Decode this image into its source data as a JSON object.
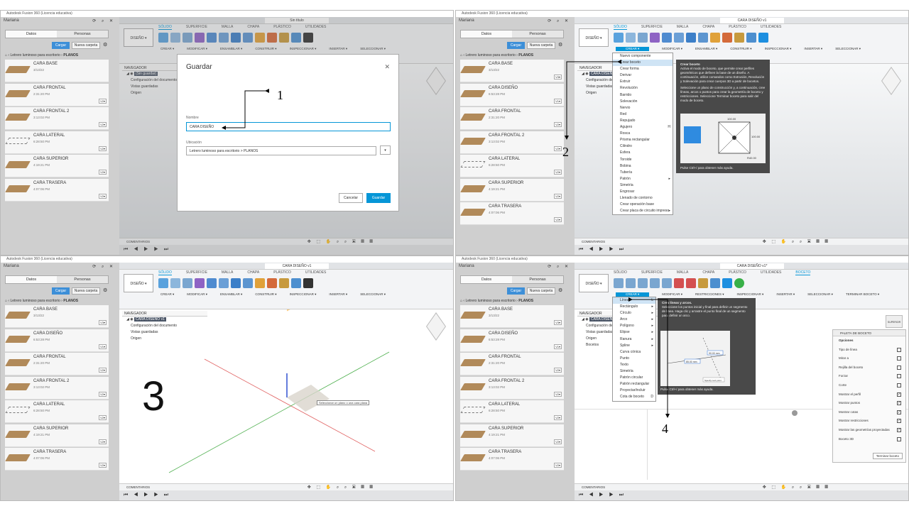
{
  "app_title": "Autodesk Fusion 360 (Licencia educativa)",
  "account": "Mariana",
  "panel": {
    "tabs": [
      "Datos",
      "Personas"
    ],
    "load_button": "Cargar",
    "new_folder_button": "Nueva carpeta",
    "breadcrumb_a": "Letrero luminoso para escritorio",
    "breadcrumb_b": "PLANOS",
    "files_q1": [
      {
        "name": "CARA BASE",
        "time": "3/13/22",
        "ver": ""
      },
      {
        "name": "CARA FRONTAL",
        "time": "2:31:20 PM",
        "ver": "V2▾"
      },
      {
        "name": "CARA FRONTAL 2",
        "time": "3:13:02 PM",
        "ver": "V2▾"
      },
      {
        "name": "CARA LATERAL",
        "time": "6:28:50 PM",
        "ver": "V2▾"
      },
      {
        "name": "CARA SUPERIOR",
        "time": "4:19:21 PM",
        "ver": "V2▾"
      },
      {
        "name": "CARA TRASERA",
        "time": "4:07:06 PM",
        "ver": "V2▾"
      }
    ],
    "files": [
      {
        "name": "CARA BASE",
        "time": "3/13/22",
        "ver": "V3▾"
      },
      {
        "name": "CARA DISEÑO",
        "time": "6:53:28 PM",
        "ver": "V1▾"
      },
      {
        "name": "CARA FRONTAL",
        "time": "2:31:20 PM",
        "ver": "V2▾"
      },
      {
        "name": "CARA FRONTAL 2",
        "time": "3:13:02 PM",
        "ver": "V2▾"
      },
      {
        "name": "CARA LATERAL",
        "time": "6:28:50 PM",
        "ver": "V2▾"
      },
      {
        "name": "CARA SUPERIOR",
        "time": "4:19:21 PM",
        "ver": "V2▾"
      },
      {
        "name": "CARA TRASERA",
        "time": "4:07:06 PM",
        "ver": "V2▾"
      }
    ]
  },
  "doc_tabs": {
    "q1": "Sin título",
    "q2": "CARA DISEÑO v1",
    "q3": "CARA DISEÑO v1",
    "q4": "CARA DISEÑO v1*"
  },
  "ribbon": {
    "design": "DISEÑO ▾",
    "tabs": [
      "SÓLIDO",
      "SUPERFICIE",
      "MALLA",
      "CHAPA",
      "PLÁSTICO",
      "UTILIDADES"
    ],
    "sketch_tab": "BOCETO",
    "groups": [
      "CREAR ▾",
      "MODIFICAR ▾",
      "ENSAMBLAR ▾",
      "CONSTRUIR ▾",
      "INSPECCIONAR ▾",
      "INSERTAR ▾",
      "SELECCIONAR ▾"
    ],
    "sketch_groups": [
      "CREAR ▾",
      "MODIFICAR ▾",
      "RESTRICCIONES ▾",
      "INSPECCIONAR ▾",
      "INSERTAR ▾",
      "SELECCIONAR ▾",
      "TERMINAR BOCETO ▾"
    ]
  },
  "navigator": {
    "header": "NAVEGADOR",
    "root_q1": "(Sin guardar)",
    "root": "CARA DISEÑO v1",
    "rows": [
      "Configuración del documento",
      "Vistas guardadas",
      "Origen"
    ],
    "rows_short": [
      "Configuración del documento",
      "Vistas guardadas",
      "Origen",
      "Bocetos"
    ]
  },
  "comments": "COMENTARIOS",
  "dialog": {
    "title": "Guardar",
    "name_label": "Nombre",
    "name_value": "CARA DISEÑO",
    "location_label": "Ubicación",
    "location_value": "Letrero luminoso para escritorio > PLANOS",
    "cancel": "Cancelar",
    "save": "Guardar"
  },
  "create_menu": [
    "Nuevo componente",
    "Crear boceto",
    "Crear forma",
    "Derivar",
    "Extruir",
    "Revolución",
    "Barrido",
    "Solevación",
    "Nervio",
    "Red",
    "Repujado",
    "Agujero",
    "Rosca",
    "Prisma rectangular",
    "Cilindro",
    "Esfera",
    "Toroide",
    "Bobina",
    "Tubería",
    "Patrón",
    "Simetría",
    "Engrosar",
    "Llenado de contorno",
    "Crear operación base",
    "Crear placa de circuito impreso"
  ],
  "hole_shortcut": "H",
  "tip_sketch": {
    "title": "Crear boceto",
    "body1": "Activa el modo de boceto, que permite crear perfiles geométricos que definen la base de un diseño. A continuación, utilice comandos como Extrusión, Revolución y Solevación para crear cuerpos 3D a partir de bocetos.",
    "body2": "Seleccione un plano de construcción y, a continuación, cree líneas, arcos o puntos para crear la geometría de boceto y restricciones. Seleccione Terminar boceto para salir del modo de boceto.",
    "footer": "Pulse Ctrl+/ para obtener más ayuda.",
    "dims": [
      "100.00",
      "100.00",
      "R40.00"
    ]
  },
  "select_hint": "Seleccionar un plano o una cara plana",
  "sketch_menu": [
    "Línea",
    "Rectángulo",
    "Círculo",
    "Arco",
    "Polígono",
    "Elipse",
    "Ranura",
    "Spline",
    "Curva cónica",
    "Punto",
    "Texto",
    "Simetría",
    "Patrón circular",
    "Patrón rectangular",
    "Proyectar/incluir",
    "Cota de boceto"
  ],
  "sketch_shortcuts": {
    "line": "L",
    "dim": "D"
  },
  "tip_line": {
    "title": "Crea líneas y arcos.",
    "body": "Seleccione los puntos inicial y final para definir un segmento de línea. Haga clic y arrastre el punto final de un segmento para definir un arco.",
    "footer": "Pulse Ctrl+/ para obtener más ayuda.",
    "dims": [
      "85.00 mm",
      "90.00 mm"
    ],
    "hint": "Specify next point"
  },
  "palette": {
    "title": "PALETA DE BOCETO",
    "section": "Opciones",
    "rows": [
      "Tipo de línea",
      "Mirar a",
      "Rejilla del boceto",
      "Forzar",
      "Corte",
      "Mostrar el perfil",
      "Mostrar puntos",
      "Mostrar cotas",
      "Mostrar restricciones",
      "Mostrar las geometrías proyectadas",
      "Boceto 3D"
    ],
    "checked": [
      false,
      false,
      false,
      false,
      false,
      true,
      true,
      true,
      true,
      true,
      false
    ],
    "end": "Terminar boceto"
  },
  "callouts": [
    "1",
    "2",
    "3",
    "4"
  ],
  "view_cube_label": "SUPERIOR"
}
